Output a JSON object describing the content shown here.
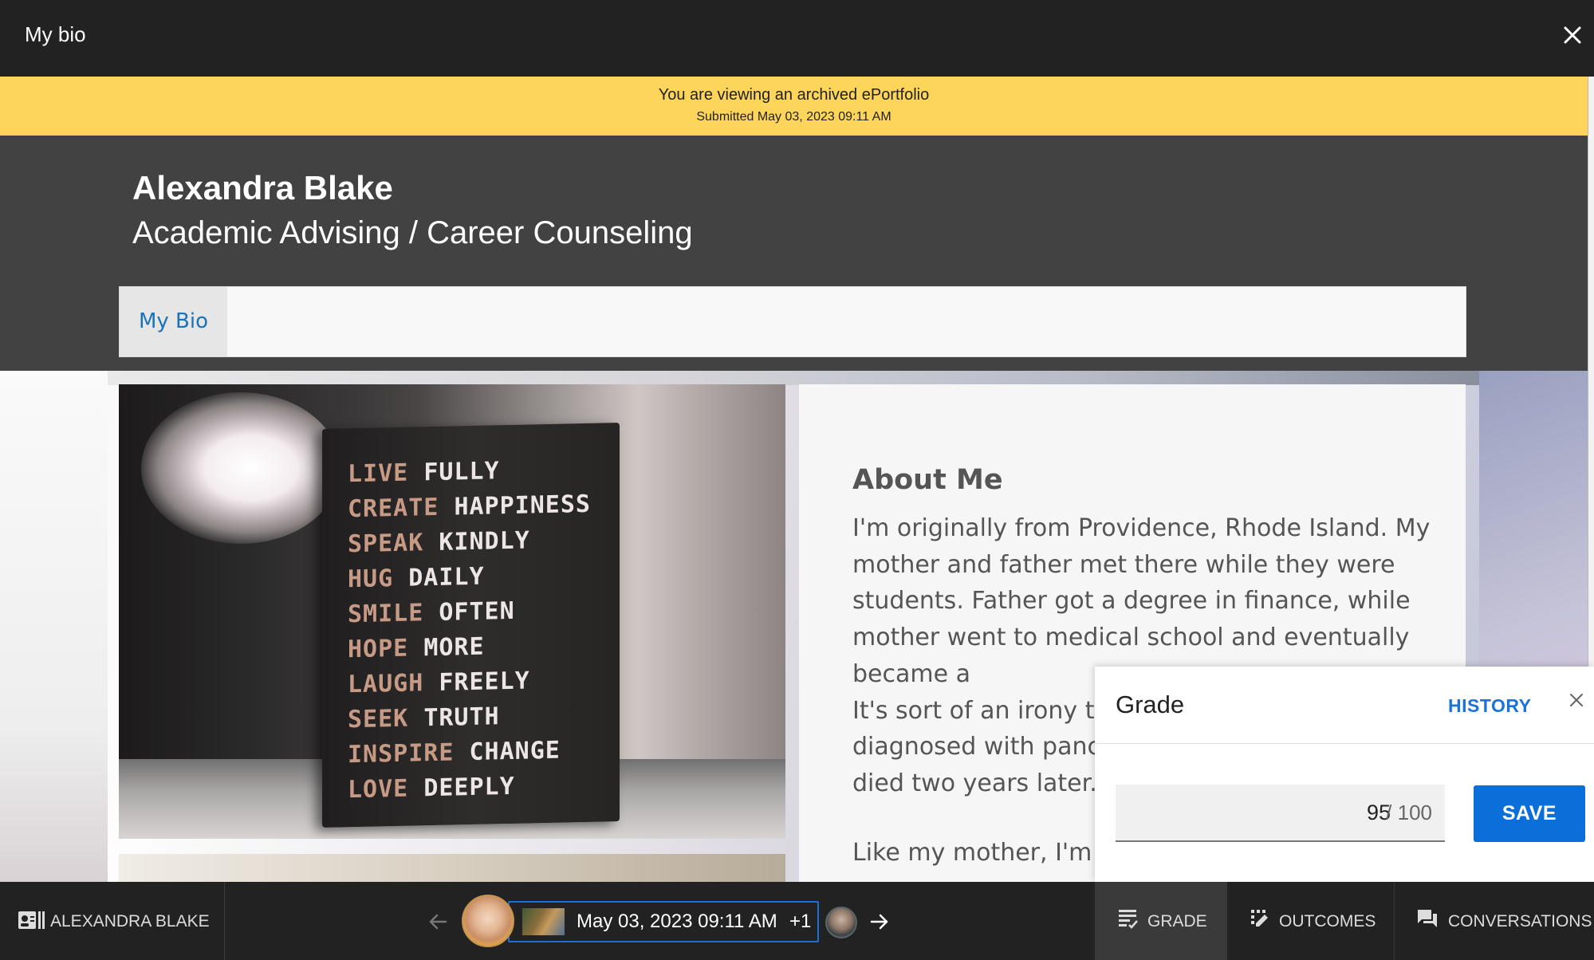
{
  "window": {
    "title": "My bio"
  },
  "banner": {
    "line1": "You are viewing an archived ePortfolio",
    "line2": "Submitted May 03, 2023 09:11 AM",
    "color": "#fcd55a"
  },
  "portfolio": {
    "owner_name": "Alexandra Blake",
    "subtitle": "Academic Advising / Career Counseling",
    "nav": [
      {
        "label": "My Bio",
        "active": true
      }
    ]
  },
  "photo_text": [
    {
      "a": "LIVE",
      "b": "FULLY"
    },
    {
      "a": "CREATE",
      "b": "HAPPINESS"
    },
    {
      "a": "SPEAK",
      "b": "KINDLY"
    },
    {
      "a": "HUG",
      "b": "DAILY"
    },
    {
      "a": "SMILE",
      "b": "OFTEN"
    },
    {
      "a": "HOPE",
      "b": "MORE"
    },
    {
      "a": "LAUGH",
      "b": "FREELY"
    },
    {
      "a": "SEEK",
      "b": "TRUTH"
    },
    {
      "a": "INSPIRE",
      "b": "CHANGE"
    },
    {
      "a": "LOVE",
      "b": "DEEPLY"
    }
  ],
  "about": {
    "heading": "About Me",
    "paragraph": "I'm originally from Providence, Rhode Island. My mother and father met there while they were students. Father got a degree in finance, while mother went to medical school and eventually became a",
    "paragraph_cont": "It's sort of an irony th",
    "paragraph_cont2": "diagnosed with panc",
    "paragraph_cont3": "died two years later.",
    "paragraph2": "Like my mother, I'm"
  },
  "grade_panel": {
    "title": "Grade",
    "history_label": "HISTORY",
    "score": "95",
    "out_of": "/ 100",
    "save_label": "SAVE",
    "accent": "#0a6fd8"
  },
  "bottom_bar": {
    "student_label": "ALEXANDRA BLAKE",
    "submission_date": "May 03, 2023 09:11 AM",
    "more_count": "+1",
    "tabs": [
      {
        "label": "GRADE",
        "icon": "grade-icon",
        "active": true
      },
      {
        "label": "OUTCOMES",
        "icon": "outcomes-icon",
        "active": false
      },
      {
        "label": "CONVERSATIONS",
        "icon": "conversations-icon",
        "active": false
      }
    ]
  }
}
